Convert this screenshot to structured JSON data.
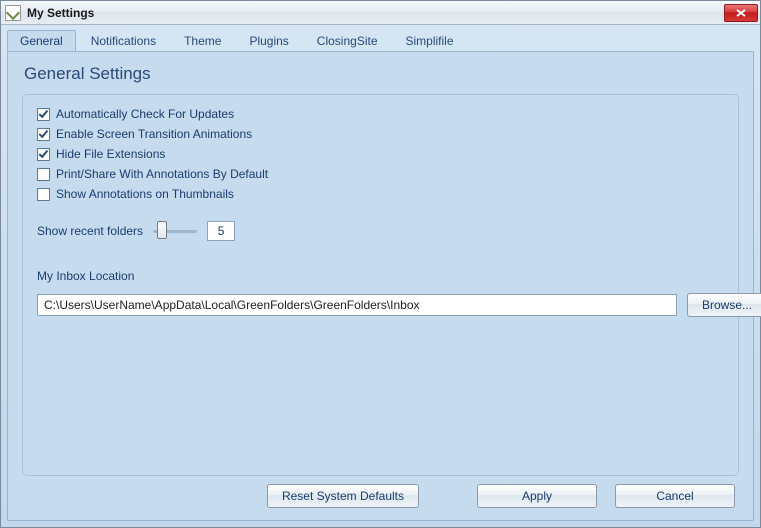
{
  "window": {
    "title": "My Settings"
  },
  "tabs": [
    {
      "label": "General",
      "active": true
    },
    {
      "label": "Notifications",
      "active": false
    },
    {
      "label": "Theme",
      "active": false
    },
    {
      "label": "Plugins",
      "active": false
    },
    {
      "label": "ClosingSite",
      "active": false
    },
    {
      "label": "Simplifile",
      "active": false
    }
  ],
  "section": {
    "title": "General Settings"
  },
  "checks": [
    {
      "label": "Automatically Check For Updates",
      "checked": true
    },
    {
      "label": "Enable Screen Transition Animations",
      "checked": true
    },
    {
      "label": "Hide File Extensions",
      "checked": true
    },
    {
      "label": "Print/Share With Annotations By Default",
      "checked": false
    },
    {
      "label": "Show Annotations on Thumbnails",
      "checked": false
    }
  ],
  "slider": {
    "label": "Show recent folders",
    "value": "5"
  },
  "inbox": {
    "label": "My Inbox Location",
    "path": "C:\\Users\\UserName\\AppData\\Local\\GreenFolders\\GreenFolders\\Inbox",
    "browse": "Browse..."
  },
  "footer": {
    "reset": "Reset System Defaults",
    "apply": "Apply",
    "cancel": "Cancel"
  }
}
